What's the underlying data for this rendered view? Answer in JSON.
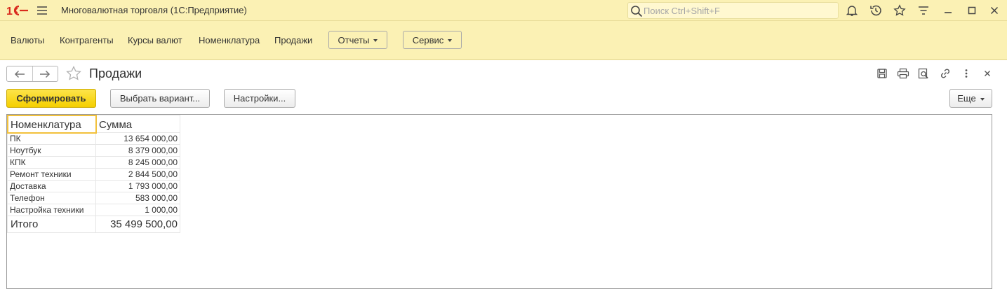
{
  "titlebar": {
    "title": "Многовалютная торговля  (1С:Предприятие)",
    "search_placeholder": "Поиск Ctrl+Shift+F",
    "icons": [
      "logo-1c-icon",
      "menu-icon",
      "search-icon",
      "bell-icon",
      "history-icon",
      "star-icon",
      "filter-icon",
      "minimize-icon",
      "maximize-icon",
      "close-icon"
    ],
    "accent": "#fbf1b4"
  },
  "sections": {
    "links": [
      "Валюты",
      "Контрагенты",
      "Курсы валют",
      "Номенклатура",
      "Продажи"
    ],
    "reports_label": "Отчеты",
    "service_label": "Сервис"
  },
  "form": {
    "title": "Продажи",
    "icons": [
      "back-arrow-icon",
      "forward-arrow-icon",
      "favorite-star-icon",
      "save-icon",
      "print-icon",
      "preview-icon",
      "link-icon",
      "more-vertical-icon",
      "close-icon"
    ]
  },
  "commands": {
    "generate": "Сформировать",
    "choose_variant": "Выбрать вариант...",
    "settings": "Настройки...",
    "more": "Еще"
  },
  "report": {
    "headers": [
      "Номенклатура",
      "Сумма"
    ],
    "rows": [
      {
        "name": "ПК",
        "sum": "13 654 000,00"
      },
      {
        "name": "Ноутбук",
        "sum": "8 379 000,00"
      },
      {
        "name": "КПК",
        "sum": "8 245 000,00"
      },
      {
        "name": "Ремонт техники",
        "sum": "2 844 500,00"
      },
      {
        "name": "Доставка",
        "sum": "1 793 000,00"
      },
      {
        "name": "Телефон",
        "sum": "583 000,00"
      },
      {
        "name": "Настройка техники",
        "sum": "1 000,00"
      }
    ],
    "total_label": "Итого",
    "total_sum": "35 499 500,00"
  },
  "colors": {
    "brand_red": "#d92b1e",
    "primary_button": "#f5cf00",
    "selected_cell": "#f2c13b"
  }
}
